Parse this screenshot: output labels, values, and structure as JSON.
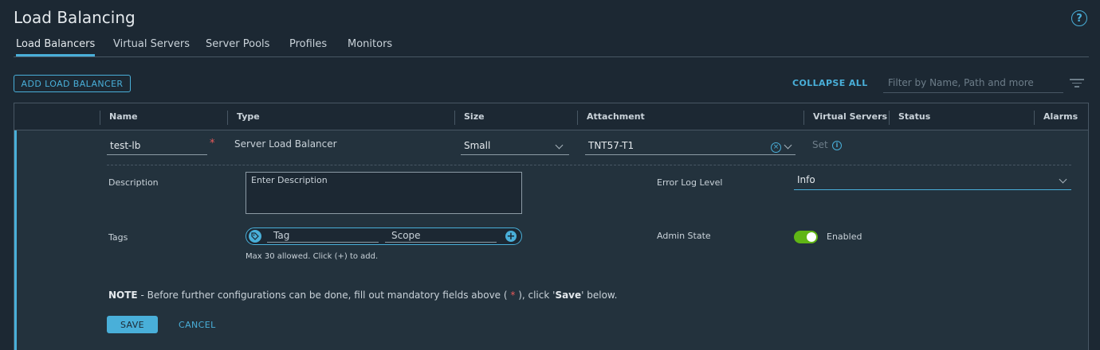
{
  "header": {
    "title": "Load Balancing",
    "help_icon": "?"
  },
  "tabs": [
    {
      "label": "Load Balancers",
      "active": true
    },
    {
      "label": "Virtual Servers",
      "active": false
    },
    {
      "label": "Server Pools",
      "active": false
    },
    {
      "label": "Profiles",
      "active": false
    },
    {
      "label": "Monitors",
      "active": false
    }
  ],
  "toolbar": {
    "add_label": "ADD LOAD BALANCER",
    "collapse_all_label": "COLLAPSE ALL",
    "filter_placeholder": "Filter by Name, Path and more"
  },
  "grid": {
    "columns": [
      "Name",
      "Type",
      "Size",
      "Attachment",
      "Virtual Servers",
      "Status",
      "Alarms"
    ]
  },
  "row": {
    "name": "test-lb",
    "required_marker": "*",
    "type": "Server Load Balancer",
    "size": "Small",
    "attachment": "TNT57-T1",
    "virtual_servers_link": "Set",
    "info_glyph": "i",
    "clear_glyph": "×"
  },
  "details": {
    "description_label": "Description",
    "description_placeholder": "Enter Description",
    "error_log_label": "Error Log Level",
    "error_log_value": "Info",
    "tags_label": "Tags",
    "tag_placeholder": "Tag",
    "scope_placeholder": "Scope",
    "tags_hint": "Max 30 allowed. Click (+) to add.",
    "plus_glyph": "+",
    "admin_state_label": "Admin State",
    "admin_state_value": "Enabled"
  },
  "note": {
    "prefix": "NOTE",
    "text1": " - Before further configurations can be done, fill out mandatory fields above ( ",
    "star": "*",
    "text2": " ), click '",
    "save_word": "Save",
    "text3": "' below."
  },
  "actions": {
    "save_label": "SAVE",
    "cancel_label": "CANCEL"
  },
  "colors": {
    "accent": "#49afd9",
    "toggle_on": "#60b515",
    "required": "#e85a5a",
    "background": "#1c2833"
  }
}
